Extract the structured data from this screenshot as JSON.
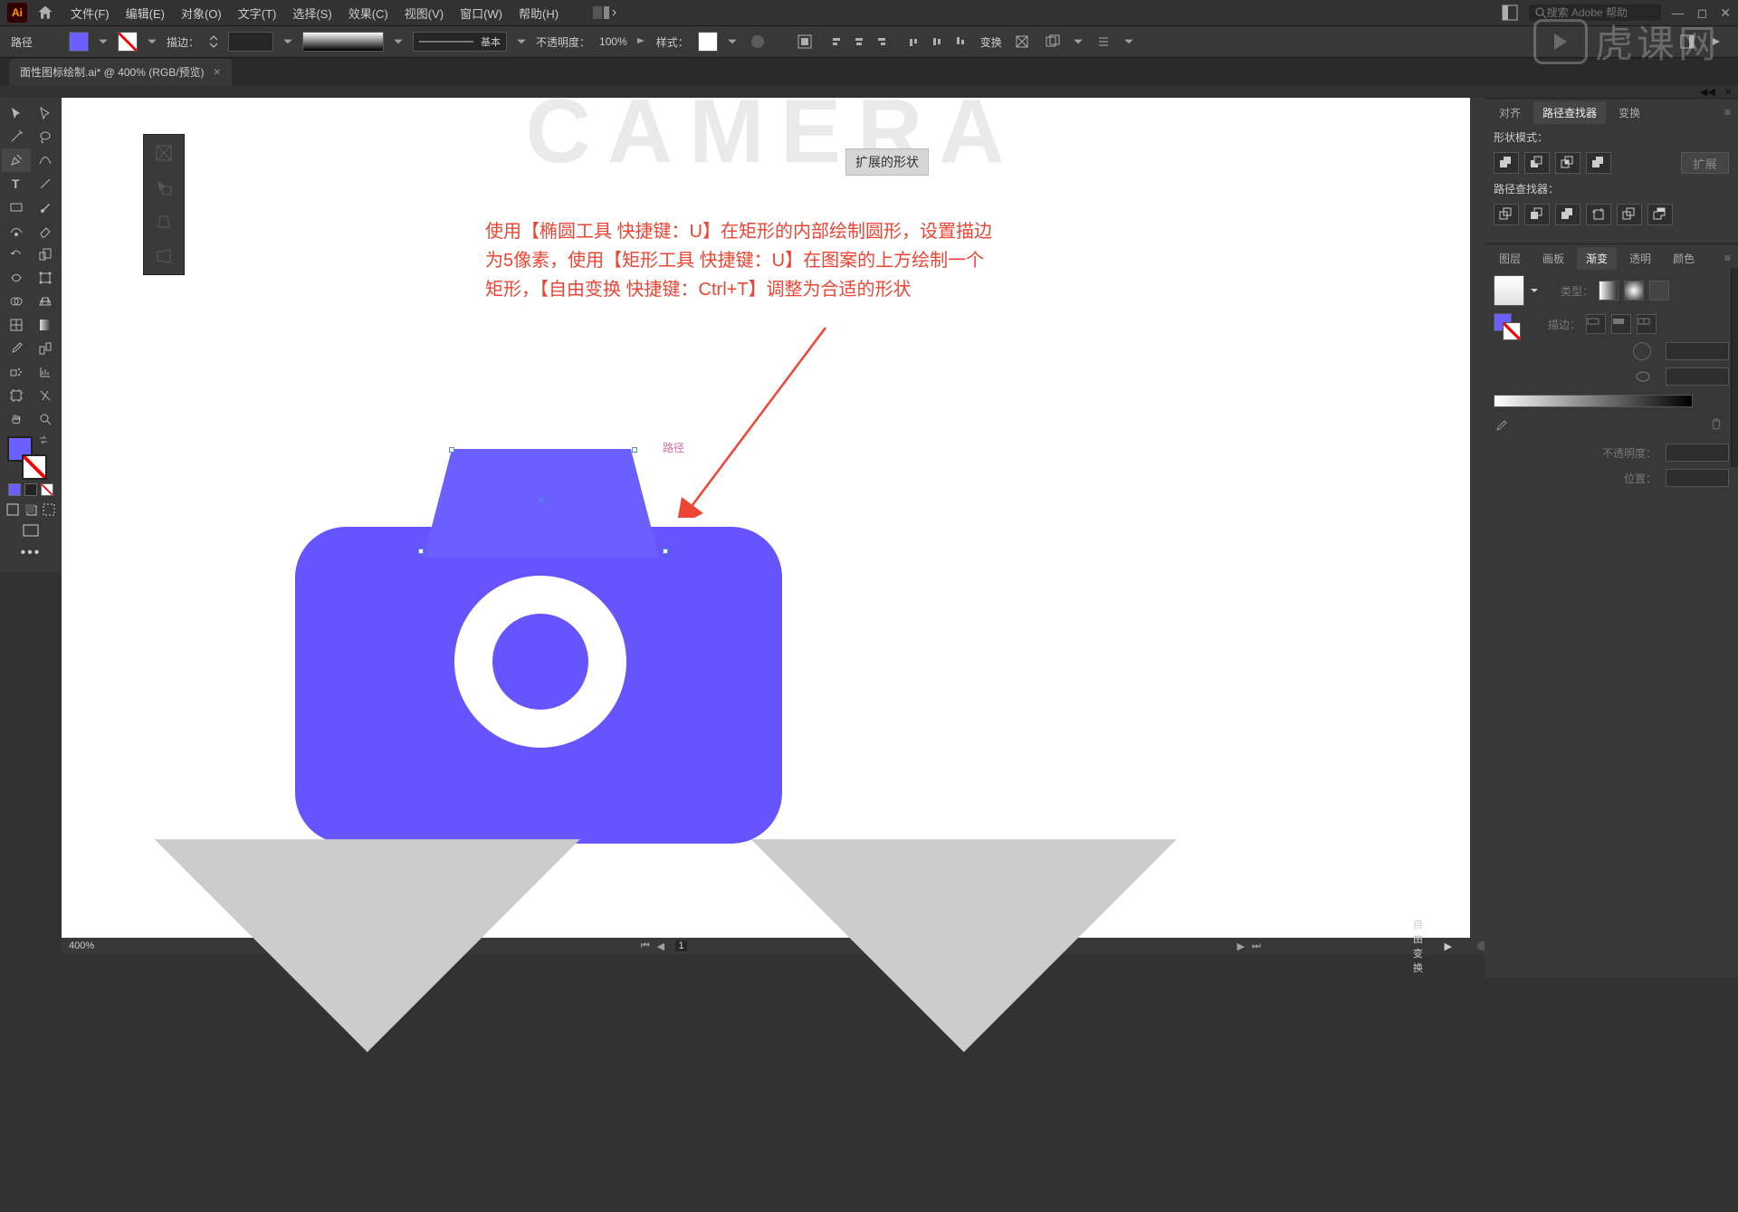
{
  "menubar": {
    "app": "Ai",
    "items": [
      "文件(F)",
      "编辑(E)",
      "对象(O)",
      "文字(T)",
      "选择(S)",
      "效果(C)",
      "视图(V)",
      "窗口(W)",
      "帮助(H)"
    ],
    "search_placeholder": "搜索 Adobe 帮助"
  },
  "options": {
    "selection_label": "路径",
    "stroke_label": "描边：",
    "profile_label": "基本",
    "opacity_label": "不透明度：",
    "opacity_value": "100%",
    "style_label": "样式：",
    "transform_label": "变换"
  },
  "tab": {
    "title": "面性图标绘制.ai* @ 400% (RGB/预览)"
  },
  "canvas": {
    "bg_text": "CAMERA",
    "expand_tag": "扩展的形状",
    "anno_line1": "使用【椭圆工具 快捷键：U】在矩形的内部绘制圆形，设置描边",
    "anno_line2": "为5像素，使用【矩形工具 快捷键：U】在图案的上方绘制一个",
    "anno_line3": "矩形，【自由变换 快捷键：Ctrl+T】调整为合适的形状",
    "sel_label": "路径"
  },
  "status": {
    "zoom": "400%",
    "artboard": "1",
    "tool": "自由变换"
  },
  "right": {
    "align_tabs": [
      "对齐",
      "路径查找器",
      "变换"
    ],
    "align_active": 1,
    "shape_mode_label": "形状模式：",
    "pathfinder_label": "路径查找器：",
    "expand_label": "扩展",
    "grad_tabs": [
      "图层",
      "画板",
      "渐变",
      "透明",
      "颜色"
    ],
    "grad_active": 2,
    "type_label": "类型：",
    "stroke_label_g": "描边：",
    "opacity_label_g": "不透明度：",
    "position_label": "位置："
  },
  "colors": {
    "primary": "#6655FF",
    "accent": "#6B5FFF",
    "anno": "#E43"
  },
  "watermark": "虎课网"
}
